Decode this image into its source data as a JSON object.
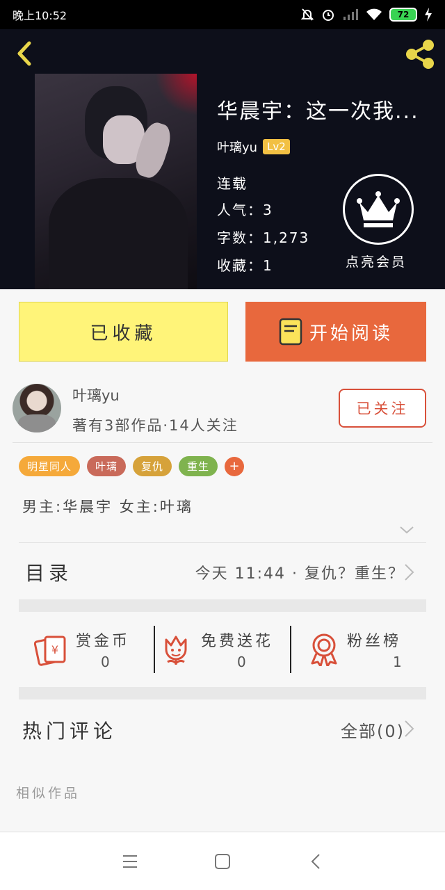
{
  "status_bar": {
    "time": "晚上10:52",
    "battery": "72"
  },
  "book": {
    "title": "华晨宇：这一次我...",
    "author": "叶璃yu",
    "level": "Lv2",
    "status": "连载",
    "popularity_label": "人气：",
    "popularity": "3",
    "words_label": "字数：",
    "words": "1,273",
    "favorites_label": "收藏：",
    "favorites": "1"
  },
  "vip": {
    "label": "点亮会员"
  },
  "actions": {
    "favorite_label": "已收藏",
    "read_label": "开始阅读"
  },
  "author_card": {
    "name": "叶璃yu",
    "stats": "著有3部作品·14人关注",
    "follow_label": "已关注"
  },
  "tags": [
    {
      "label": "明星同人",
      "color": "#f5a93a"
    },
    {
      "label": "叶璃",
      "color": "#c96a5a"
    },
    {
      "label": "复仇",
      "color": "#d6a23a"
    },
    {
      "label": "重生",
      "color": "#7fb34e"
    }
  ],
  "tag_add_label": "+",
  "roles": "男主:华晨宇   女主:叶璃",
  "toc": {
    "title": "目录",
    "latest": "今天 11:44 · 复仇？重生？"
  },
  "stats": [
    {
      "label": "赏金币",
      "value": "0"
    },
    {
      "label": "免费送花",
      "value": "0"
    },
    {
      "label": "粉丝榜",
      "value": "1"
    }
  ],
  "comments": {
    "title": "热门评论",
    "all_label": "全部(0)"
  },
  "similar_label": "相似作品",
  "colors": {
    "accent_orange": "#e8683d",
    "fav_yellow": "#fff479",
    "follow_red": "#d8503a",
    "icon_gold": "#e8d54a"
  }
}
